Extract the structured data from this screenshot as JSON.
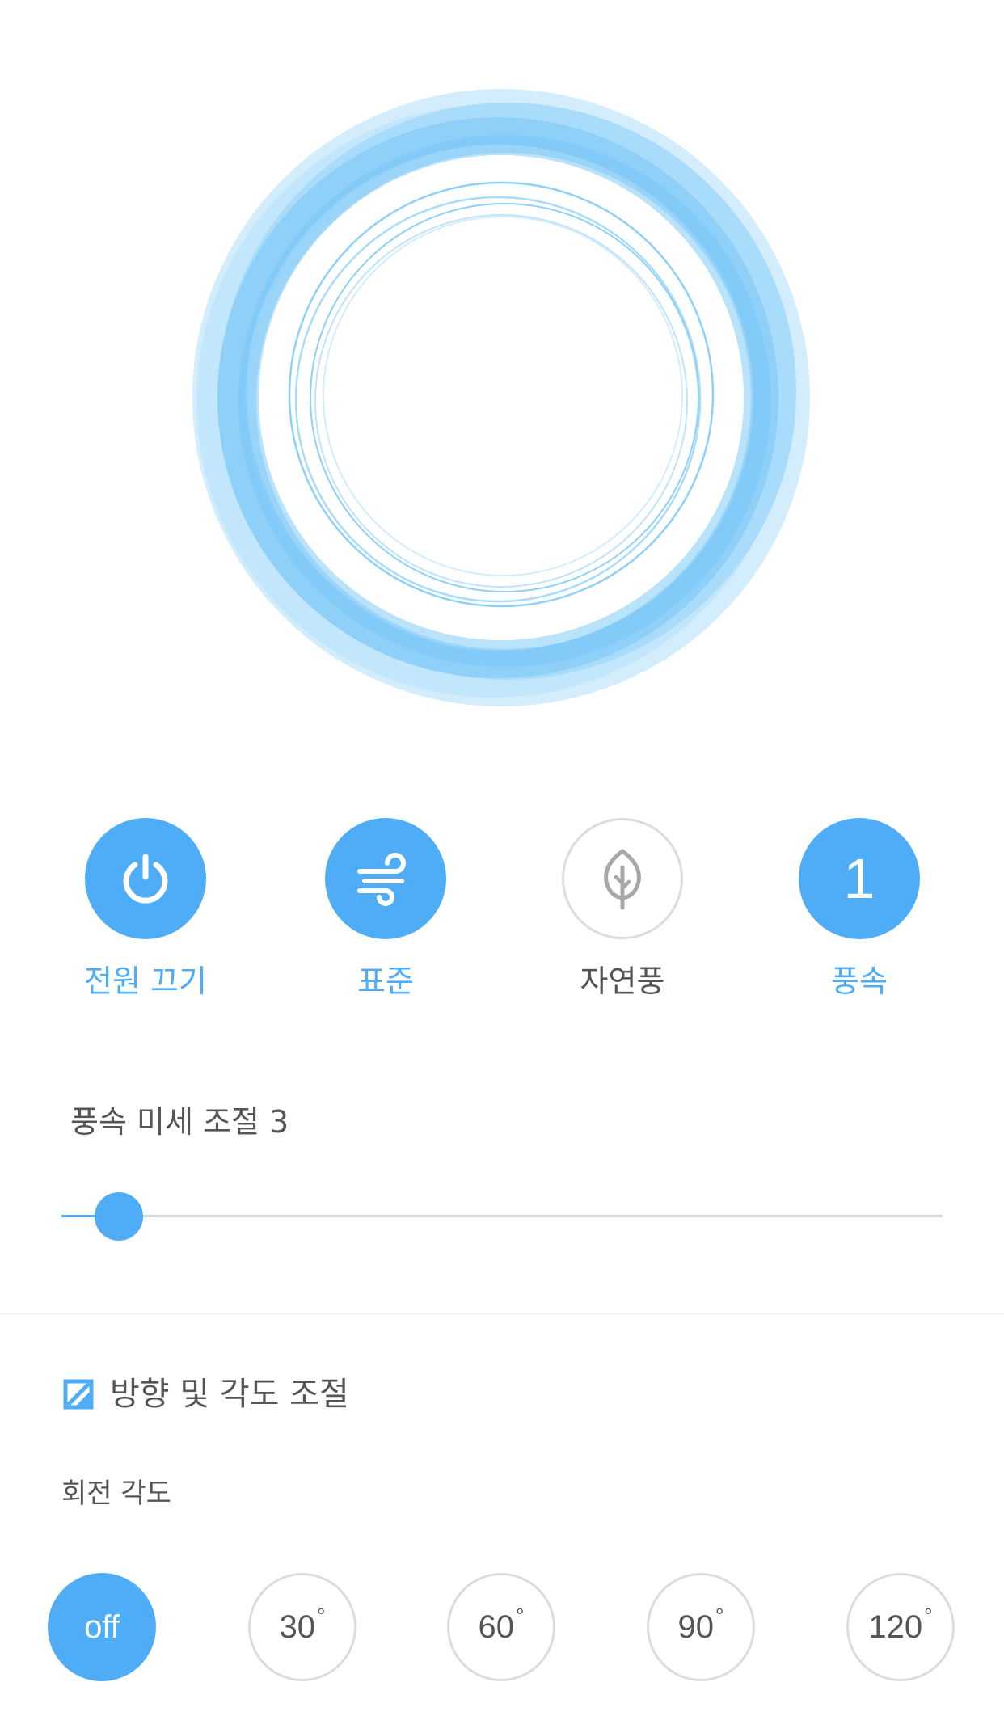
{
  "colors": {
    "accent": "#4fadf7",
    "inactive_border": "#dcdcdc",
    "text": "#555555",
    "ring_light": "#bfe4fb",
    "ring_mid": "#8fd0f9"
  },
  "controls": [
    {
      "id": "power",
      "label": "전원 끄기",
      "icon": "power-icon",
      "active": true
    },
    {
      "id": "mode-standard",
      "label": "표준",
      "icon": "wind-icon",
      "active": true
    },
    {
      "id": "mode-natural",
      "label": "자연풍",
      "icon": "leaf-icon",
      "active": false
    },
    {
      "id": "speed",
      "label": "풍속",
      "value": "1",
      "active": true
    }
  ],
  "fine_speed": {
    "label": "풍속 미세 조절 3",
    "level_fraction": 0.02
  },
  "direction": {
    "title": "방향 및 각도 조절",
    "checked": true,
    "icon": "checkbox-icon"
  },
  "rotation": {
    "label": "회전 각도",
    "degree_symbol": "°",
    "options": [
      {
        "text": "off",
        "selected": true
      },
      {
        "text": "30",
        "selected": false
      },
      {
        "text": "60",
        "selected": false
      },
      {
        "text": "90",
        "selected": false
      },
      {
        "text": "120",
        "selected": false
      }
    ]
  }
}
